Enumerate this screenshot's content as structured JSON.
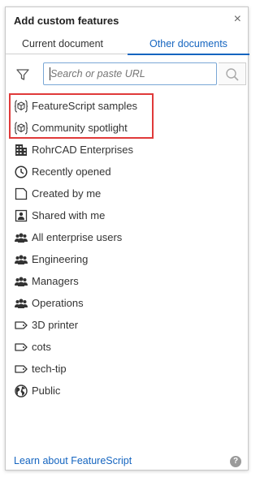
{
  "panel": {
    "title": "Add custom features",
    "close_glyph": "×"
  },
  "tabs": [
    {
      "label": "Current document",
      "active": false
    },
    {
      "label": "Other documents",
      "active": true
    }
  ],
  "search": {
    "placeholder": "Search or paste URL",
    "value": ""
  },
  "list": {
    "items": [
      {
        "label": "FeatureScript samples",
        "icon": "featurescript-icon"
      },
      {
        "label": "Community spotlight",
        "icon": "featurescript-icon"
      },
      {
        "label": "RohrCAD Enterprises",
        "icon": "enterprise-building-icon"
      },
      {
        "label": "Recently opened",
        "icon": "clock-icon"
      },
      {
        "label": "Created by me",
        "icon": "document-icon"
      },
      {
        "label": "Shared with me",
        "icon": "shared-person-icon"
      },
      {
        "label": "All enterprise users",
        "icon": "users-group-icon"
      },
      {
        "label": "Engineering",
        "icon": "users-group-icon"
      },
      {
        "label": "Managers",
        "icon": "users-group-icon"
      },
      {
        "label": "Operations",
        "icon": "users-group-icon"
      },
      {
        "label": "3D printer",
        "icon": "label-tag-icon"
      },
      {
        "label": "cots",
        "icon": "label-tag-icon"
      },
      {
        "label": "tech-tip",
        "icon": "label-tag-icon"
      },
      {
        "label": "Public",
        "icon": "globe-icon"
      }
    ]
  },
  "footer": {
    "link": "Learn about FeatureScript",
    "help_glyph": "?"
  },
  "colors": {
    "accent": "#1565c0",
    "highlight": "#e03a3a",
    "text": "#333333"
  }
}
